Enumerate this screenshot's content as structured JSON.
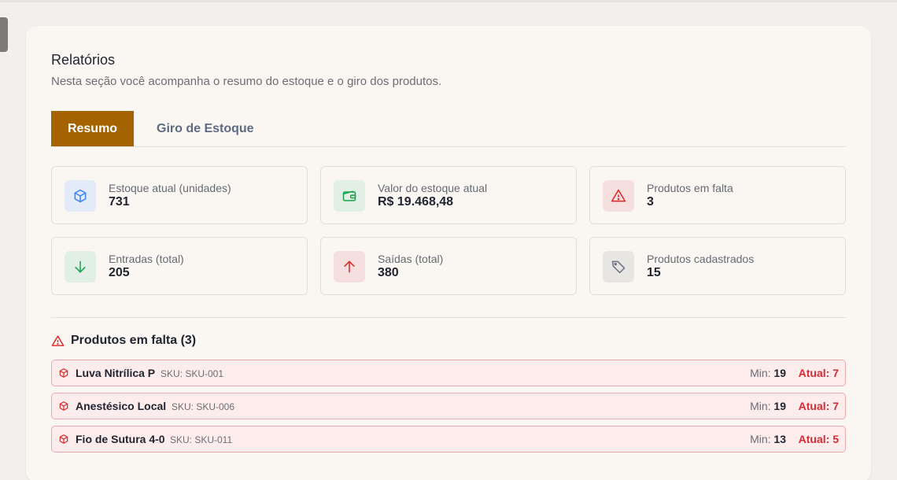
{
  "header": {
    "title": "Relatórios",
    "subtitle": "Nesta seção você acompanha o resumo do estoque e o giro dos produtos."
  },
  "tabs": [
    {
      "label": "Resumo",
      "active": true
    },
    {
      "label": "Giro de Estoque",
      "active": false
    }
  ],
  "stats": [
    {
      "label": "Estoque atual (unidades)",
      "value": "731",
      "icon": "box-icon",
      "color": "#3b82f6"
    },
    {
      "label": "Valor do estoque atual",
      "value": "R$ 19.468,48",
      "icon": "wallet-icon",
      "color": "#16a34a"
    },
    {
      "label": "Produtos em falta",
      "value": "3",
      "icon": "warning-icon",
      "color": "#dc2626"
    },
    {
      "label": "Entradas (total)",
      "value": "205",
      "icon": "arrow-down-icon",
      "color": "#16a34a"
    },
    {
      "label": "Saídas (total)",
      "value": "380",
      "icon": "arrow-up-icon",
      "color": "#dc2626"
    },
    {
      "label": "Produtos cadastrados",
      "value": "15",
      "icon": "tag-icon",
      "color": "#6b7280"
    }
  ],
  "shortage": {
    "title": "Produtos em falta (3)",
    "min_label": "Min:",
    "current_label": "Atual:",
    "items": [
      {
        "name": "Luva Nitrílica P",
        "sku": "SKU: SKU-001",
        "min": "19",
        "current": "7"
      },
      {
        "name": "Anestésico Local",
        "sku": "SKU: SKU-006",
        "min": "19",
        "current": "7"
      },
      {
        "name": "Fio de Sutura 4-0",
        "sku": "SKU: SKU-011",
        "min": "13",
        "current": "5"
      }
    ]
  }
}
